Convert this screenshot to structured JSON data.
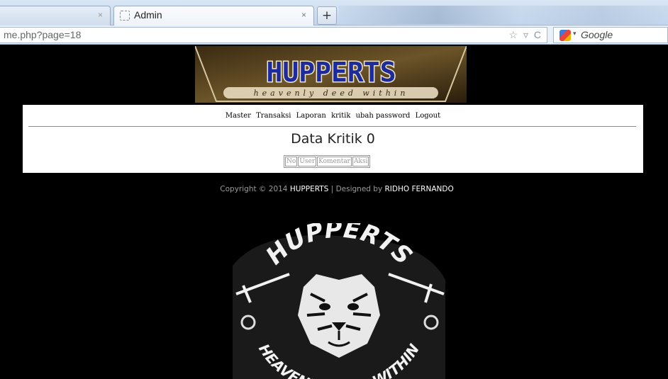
{
  "browser": {
    "tabs": [
      {
        "label": "",
        "close": "×"
      },
      {
        "label": "Admin",
        "close": "×"
      }
    ],
    "new_tab": "+",
    "url": "me.php?page=18",
    "url_icons": {
      "bookmark": "☆",
      "dropdown": "▿",
      "reload": "C"
    },
    "search_placeholder": "Google",
    "search_dropdown": "▾"
  },
  "banner": {
    "title": "HUPPERTS",
    "tagline": "heavenly deed within"
  },
  "menu": [
    "Master",
    "Transaksi",
    "Laporan",
    "kritik",
    "ubah password",
    "Logout"
  ],
  "heading": "Data Kritik 0",
  "table": {
    "columns": [
      "No",
      "User",
      "Komentar",
      "Aksi"
    ]
  },
  "footer": {
    "prefix": "Copyright © 2014",
    "brand": "HUPPERTS",
    "separator": "|",
    "designed_by": "Designed by",
    "designer": "RIDHO FERNANDO"
  },
  "emblem": {
    "top_text": "HUPPERTS",
    "bottom_text": "HEAVENLY DEED WITHIN"
  },
  "colors": {
    "page_background": "#000000",
    "content_background": "#ffffff",
    "footer_text": "#9a9a9a",
    "banner_text": "#1d2b9c"
  }
}
